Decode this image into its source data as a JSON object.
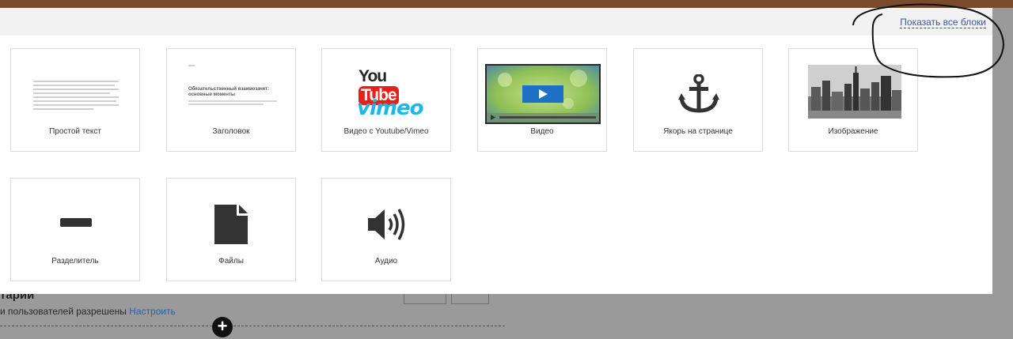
{
  "modal": {
    "show_all_link": "Показать все блоки",
    "tiles": [
      {
        "label": "Простой текст",
        "icon": "text-lines-icon"
      },
      {
        "label": "Заголовок",
        "icon": "heading-preview-icon",
        "preview_title": "Обязательственный взаимозачет:\nосновные моменты"
      },
      {
        "label": "Видео с Youtube/Vimeo",
        "icon": "youtube-vimeo-logo",
        "youtube_text": "YouTube",
        "vimeo_text": "vimeo"
      },
      {
        "label": "Видео",
        "icon": "video-player-icon"
      },
      {
        "label": "Якорь на странице",
        "icon": "anchor-icon"
      },
      {
        "label": "Изображение",
        "icon": "city-image-icon"
      },
      {
        "label": "Разделитель",
        "icon": "divider-icon"
      },
      {
        "label": "Файлы",
        "icon": "file-icon"
      },
      {
        "label": "Аудио",
        "icon": "speaker-icon"
      }
    ]
  },
  "background_page": {
    "title_fragment": "тарии",
    "subtitle_text": "и пользователей разрешены",
    "subtitle_link": "Настроить",
    "add_button": "+"
  },
  "colors": {
    "overlay": "#9a9a9a",
    "top_bar": "#7a4a2c",
    "link": "#3a55a0",
    "youtube_red": "#e62117",
    "vimeo_blue": "#1ab7ea"
  }
}
